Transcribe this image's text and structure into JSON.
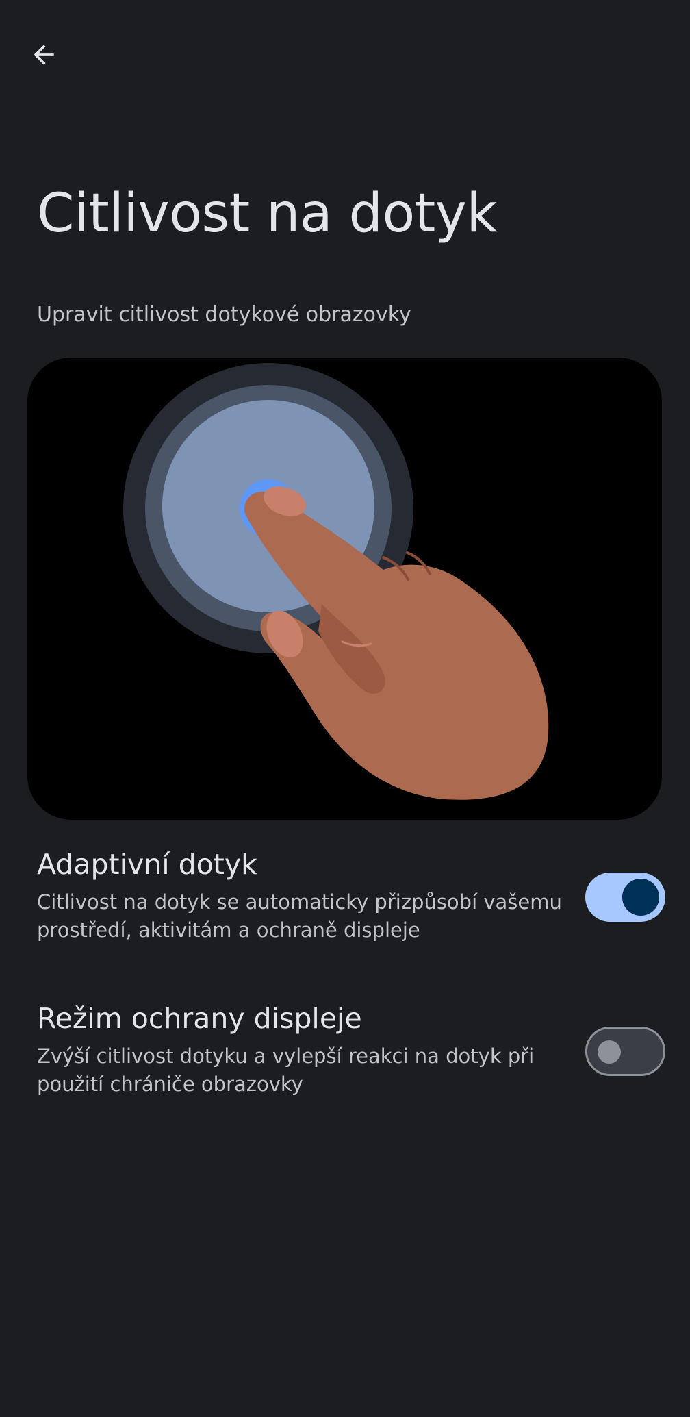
{
  "header": {
    "back_icon": "arrow-left-icon",
    "title": "Citlivost na dotyk",
    "subtitle": "Upravit citlivost dotykové obrazovky"
  },
  "illustration": {
    "icon": "touch-finger-illustration"
  },
  "settings": [
    {
      "title": "Adaptivní dotyk",
      "description": "Citlivost na dotyk se automaticky přizpůsobí vašemu prostředí, aktivitám a ochraně displeje",
      "enabled": true
    },
    {
      "title": "Režim ochrany displeje",
      "description": "Zvýší citlivost dotyku a vylepší reakci na dotyk při použití chrániče obrazovky",
      "enabled": false
    }
  ],
  "colors": {
    "background": "#1b1d20",
    "switch_on_track": "#a6c8ff",
    "switch_on_thumb": "#003258",
    "switch_off_track": "#3b3f45",
    "switch_off_outline": "#8d9199"
  }
}
